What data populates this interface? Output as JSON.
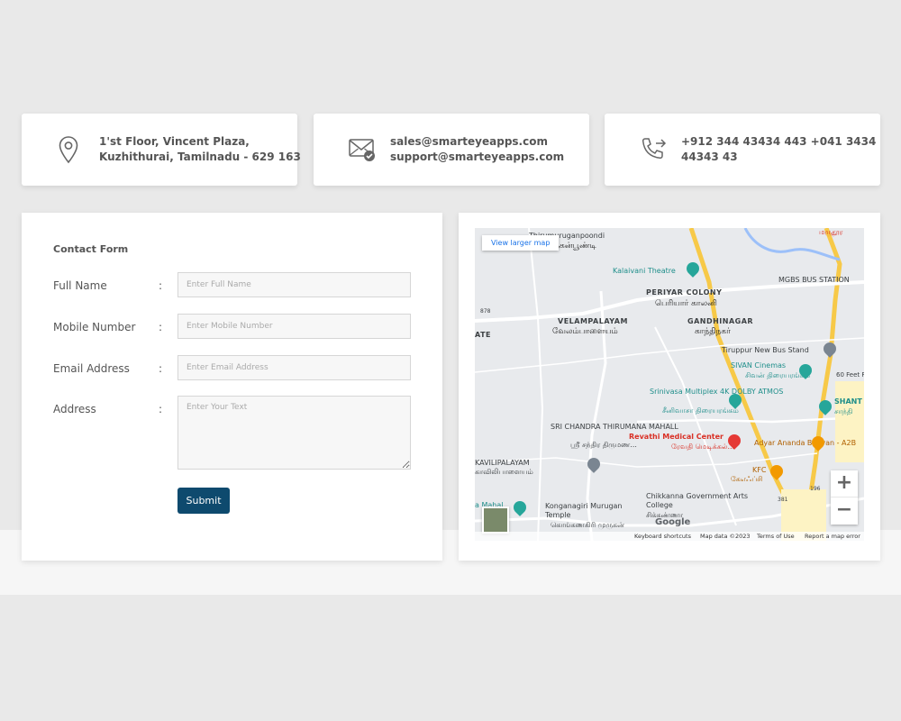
{
  "contact_cards": {
    "address": {
      "icon": "location-pin-icon",
      "line1": "1'st Floor, Vincent Plaza,",
      "line2": "Kuzhithurai, Tamilnadu - 629 163"
    },
    "email": {
      "icon": "mail-check-icon",
      "line1": "sales@smarteyeapps.com",
      "line2": "support@smarteyeapps.com"
    },
    "phone": {
      "icon": "phone-forward-icon",
      "line1": "+912 344 43434 443 +041 3434",
      "line2": "44343 43"
    }
  },
  "form": {
    "title": "Contact Form",
    "colon": ":",
    "full_name": {
      "label": "Full Name",
      "placeholder": "Enter Full Name",
      "value": ""
    },
    "mobile": {
      "label": "Mobile Number",
      "placeholder": "Enter Mobile Number",
      "value": ""
    },
    "email": {
      "label": "Email Address",
      "placeholder": "Enter Email Address",
      "value": ""
    },
    "address": {
      "label": "Address",
      "placeholder": "Enter Your Text",
      "value": ""
    },
    "submit_label": "Submit"
  },
  "map": {
    "view_larger": "View larger map",
    "zoom_in": "+",
    "zoom_out": "−",
    "labels": {
      "thirumuruganpoondi_en": "Thirumuruganpoondi",
      "thirumuruganpoondi_ta": "திருமுருகன்பூண்டி",
      "marudhu_ta": "மருதூர",
      "kalaivani": "Kalaivani Theatre",
      "mgbs": "MGBS BUS STATION",
      "periyar_en": "PERIYAR COLONY",
      "periyar_ta": "பெரியார் காலனி",
      "velampalayam_en": "VELAMPALAYAM",
      "velampalayam_ta": "வேலம்பாளையம்",
      "gandhinagar_en": "GANDHINAGAR",
      "gandhinagar_ta": "காந்திநகர்",
      "road_878": "878",
      "ate": "ATE",
      "tiruppur_bus": "Tiruppur New Bus Stand",
      "feet_road": "60 Feet R",
      "sivan_en": "SIVAN Cinemas",
      "sivan_ta": "சிவன் திரையரங்கம்",
      "srinivasa_en": "Srinivasa Multiplex 4K DOLBY ATMOS",
      "srinivasa_ta": "சீனிவாசா திரையரங்கம்",
      "shanthi_en": "SHANT",
      "shanthi_ta": "சாந்தி",
      "sri_chandra_en": "SRI CHANDRA THIRUMANA MAHALL",
      "sri_chandra_ta": "ஸ்ரீ சந்திர திருமண...",
      "revathi_en": "Revathi Medical Center",
      "revathi_ta": "ரேவதி மெடிக்கல்...",
      "adyar_en": "Adyar Ananda Bhavan - A2B",
      "kavilipalayam_en": "KAVILIPALAYAM",
      "kavilipalayam_ta": "காவிலிபாளையம்",
      "kfc_en": "KFC",
      "kfc_ta": "கேஎஃப்சி",
      "road_381": "381",
      "road_196": "196",
      "chikkanna_en": "Chikkanna Government Arts College",
      "chikkanna_ta": "சிக்கண்ணா",
      "konganagiri_en": "Konganagiri Murugan Temple",
      "konganagiri_ta": "கொங்கணகிரி முருகன்",
      "sa_mahal": "a Mahal"
    },
    "attribution": {
      "keyboard": "Keyboard shortcuts",
      "data": "Map data ©2023",
      "terms": "Terms of Use",
      "report": "Report a map error",
      "google": "Google"
    }
  }
}
